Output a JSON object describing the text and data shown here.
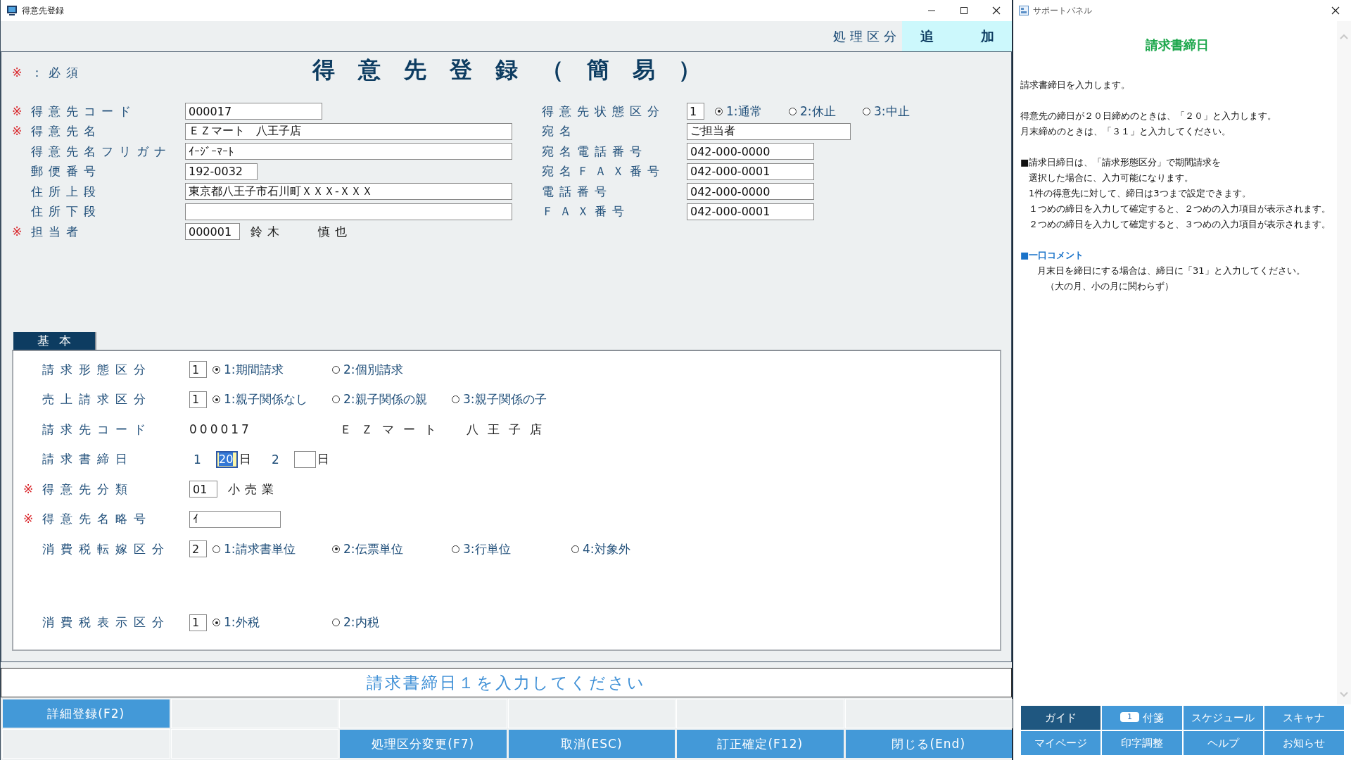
{
  "window": {
    "title": "得意先登録"
  },
  "mode": {
    "label": "処理区分",
    "value": "追　加"
  },
  "required_note": {
    "mark": "※",
    "text": "：必須"
  },
  "heading": "得意先登録（簡易）",
  "left_fields": [
    {
      "mark": "※",
      "label": "得意先コード",
      "kind": "code",
      "value": "000017"
    },
    {
      "mark": "※",
      "label": "得意先名",
      "kind": "long",
      "value": "ＥＺマート　八王子店"
    },
    {
      "label": "得意先名フリガナ",
      "kind": "long",
      "value": "ｲｰｼﾞｰﾏｰﾄ"
    },
    {
      "label": "郵便番号",
      "kind": "zip",
      "value": "192-0032"
    },
    {
      "label": "住所上段",
      "kind": "long",
      "value": "東京都八王子市石川町ＸＸＸ-ＸＸＸ"
    },
    {
      "label": "住所下段",
      "kind": "long"
    },
    {
      "mark": "※",
      "label": "担当者",
      "kind": "person",
      "value": "000001",
      "name": "鈴木　　慎也"
    }
  ],
  "right_fields": [
    {
      "label": "得意先状態区分",
      "kind": "radio",
      "value": "1",
      "options": [
        {
          "label": "1:通常",
          "selected": true
        },
        {
          "label": "2:休止",
          "selected": false
        },
        {
          "label": "3:中止",
          "selected": false
        }
      ]
    },
    {
      "label": "宛名",
      "kind": "medium",
      "value": "ご担当者"
    },
    {
      "label": "宛名電話番号",
      "kind": "phone",
      "value": "042-000-0000"
    },
    {
      "label": "宛名ＦＡＸ番号",
      "kind": "phone",
      "value": "042-000-0001"
    },
    {
      "label": "電話番号",
      "kind": "phone",
      "value": "042-000-0000"
    },
    {
      "label": "ＦＡＸ番号",
      "kind": "phone",
      "value": "042-000-0001"
    }
  ],
  "tabs": [
    {
      "label": "基本",
      "selected": true
    }
  ],
  "tab_rows": [
    {
      "label": "請求形態区分",
      "kind": "radio",
      "value": "1",
      "options": [
        {
          "label": "1:期間請求",
          "selected": true
        },
        {
          "label": "2:個別請求",
          "selected": false
        }
      ]
    },
    {
      "label": "売上請求区分",
      "kind": "radio",
      "value": "1",
      "options": [
        {
          "label": "1:親子関係なし",
          "selected": true
        },
        {
          "label": "2:親子関係の親",
          "selected": false
        },
        {
          "label": "3:親子関係の子",
          "selected": false
        }
      ]
    },
    {
      "label": "請求先コード",
      "kind": "display",
      "value": "000017",
      "name": "ＥＺマート　八王子店"
    },
    {
      "label": "請求書締日",
      "kind": "days",
      "days": [
        {
          "index": "1",
          "value": "20",
          "unit": "日",
          "focused": true
        },
        {
          "index": "2",
          "unit": "日",
          "focused": false
        }
      ]
    },
    {
      "mark": "※",
      "label": "得意先分類",
      "kind": "class",
      "value": "01",
      "name": "小売業"
    },
    {
      "mark": "※",
      "label": "得意先名略号",
      "kind": "text",
      "value": "ｲ"
    },
    {
      "label": "消費税転嫁区分",
      "kind": "radio",
      "value": "2",
      "options": [
        {
          "label": "1:請求書単位",
          "selected": false
        },
        {
          "label": "2:伝票単位",
          "selected": true
        },
        {
          "label": "3:行単位",
          "selected": false
        },
        {
          "label": "4:対象外",
          "selected": false
        }
      ]
    },
    {
      "label": "消費税表示区分",
      "kind": "radio",
      "value": "1",
      "options": [
        {
          "label": "1:外税",
          "selected": true
        },
        {
          "label": "2:内税",
          "selected": false
        }
      ]
    }
  ],
  "message": "請求書締日１を入力してください",
  "function_keys": [
    [
      {
        "kind": "key",
        "label": "詳細登録(F2)"
      },
      {
        "kind": "blank"
      },
      {
        "kind": "blank"
      },
      {
        "kind": "blank"
      },
      {
        "kind": "blank"
      },
      {
        "kind": "blank"
      }
    ],
    [
      {
        "kind": "blank"
      },
      {
        "kind": "blank"
      },
      {
        "kind": "key",
        "label": "処理区分変更(F7)"
      },
      {
        "kind": "key",
        "label": "取消(ESC)"
      },
      {
        "kind": "key",
        "label": "訂正確定(F12)"
      },
      {
        "kind": "key",
        "label": "閉じる(End)"
      }
    ]
  ],
  "support_panel": {
    "title": "サポートパネル",
    "heading": "請求書締日",
    "blocks": [
      {
        "kind": "text",
        "lines": [
          "請求書締日を入力します。"
        ]
      },
      {
        "kind": "text",
        "lines": [
          "得意先の締日が２０日締めのときは、「２０」と入力します。",
          "月末締めのときは、「３１」と入力してください。"
        ]
      },
      {
        "kind": "bullet",
        "heading": "■請求日締日は、「請求形態区分」で期間請求を",
        "lines": [
          "選択した場合に、入力可能になります。",
          "1件の得意先に対して、締日は3つまで設定できます。",
          "１つめの締日を入力して確定すると、２つめの入力項目が表示されます。",
          "２つめの締日を入力して確定すると、３つめの入力項目が表示されます。"
        ]
      },
      {
        "kind": "comment",
        "heading": "■一口コメント",
        "lines": [
          "月末日を締日にする場合は、締日に「31」と入力してください。",
          "（大の月、小の月に関わらず）"
        ]
      }
    ],
    "buttons": [
      {
        "label": "ガイド",
        "selected": true
      },
      {
        "label": "付箋",
        "selected": false,
        "badge": "1"
      },
      {
        "label": "スケジュール",
        "selected": false
      },
      {
        "label": "スキャナ",
        "selected": false
      },
      {
        "label": "マイページ",
        "selected": false
      },
      {
        "label": "印字調整",
        "selected": false
      },
      {
        "label": "ヘルプ",
        "selected": false
      },
      {
        "label": "お知らせ",
        "selected": false
      }
    ]
  }
}
